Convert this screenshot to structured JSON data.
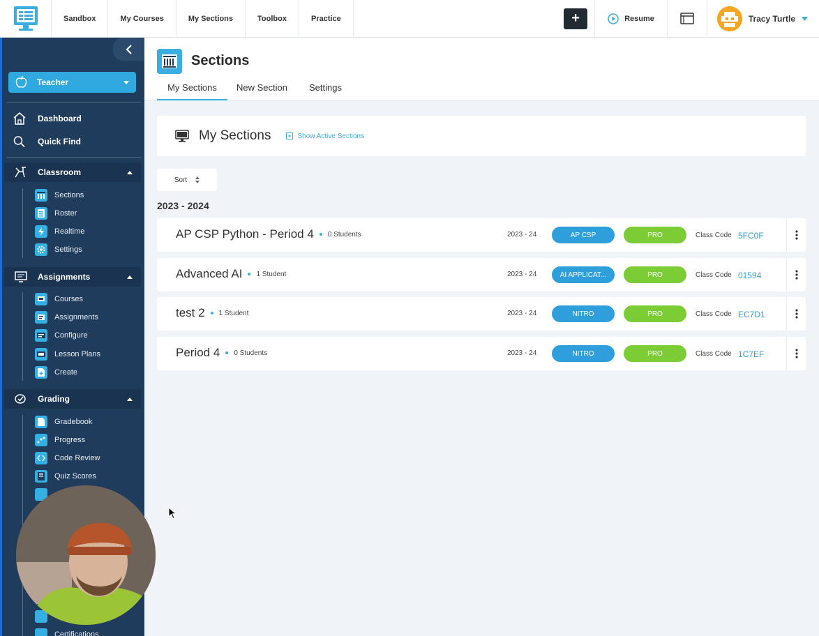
{
  "topnav": {
    "items": [
      "Sandbox",
      "My Courses",
      "My Sections",
      "Toolbox",
      "Practice"
    ],
    "plus_label": "+",
    "resume_label": "Resume",
    "user_name": "Tracy Turtle"
  },
  "sidebar": {
    "role": "Teacher",
    "links": [
      "Dashboard",
      "Quick Find"
    ],
    "groups": [
      {
        "label": "Classroom",
        "items": [
          "Sections",
          "Roster",
          "Realtime",
          "Settings"
        ]
      },
      {
        "label": "Assignments",
        "items": [
          "Courses",
          "Assignments",
          "Configure",
          "Lesson Plans",
          "Create"
        ]
      },
      {
        "label": "Grading",
        "items": [
          "Gradebook",
          "Progress",
          "Code Review",
          "Quiz Scores"
        ]
      }
    ],
    "bottom_item": "Certifications"
  },
  "page": {
    "title": "Sections",
    "tabs": [
      "My Sections",
      "New Section",
      "Settings"
    ]
  },
  "card": {
    "title": "My Sections",
    "show_active": "Show Active Sections",
    "sort_label": "Sort",
    "year_heading": "2023 - 2024"
  },
  "sections": [
    {
      "name": "AP CSP Python - Period 4",
      "students": "0 Students",
      "term": "2023 - 24",
      "course": "AP CSP",
      "tier": "PRO",
      "code_label": "Class Code",
      "code": "5FC0F"
    },
    {
      "name": "Advanced AI",
      "students": "1 Student",
      "term": "2023 - 24",
      "course": "AI APPLICAT...",
      "tier": "PRO",
      "code_label": "Class Code",
      "code": "01594"
    },
    {
      "name": "test 2",
      "students": "1 Student",
      "term": "2023 - 24",
      "course": "NITRO",
      "tier": "PRO",
      "code_label": "Class Code",
      "code": "EC7D1"
    },
    {
      "name": "Period 4",
      "students": "0 Students",
      "term": "2023 - 24",
      "course": "NITRO",
      "tier": "PRO",
      "code_label": "Class Code",
      "code": "1C7EF"
    }
  ],
  "colors": {
    "accent": "#3aaee0",
    "sidebar": "#1f3c5c",
    "pro": "#7ccc35",
    "course": "#2f9fdb"
  }
}
